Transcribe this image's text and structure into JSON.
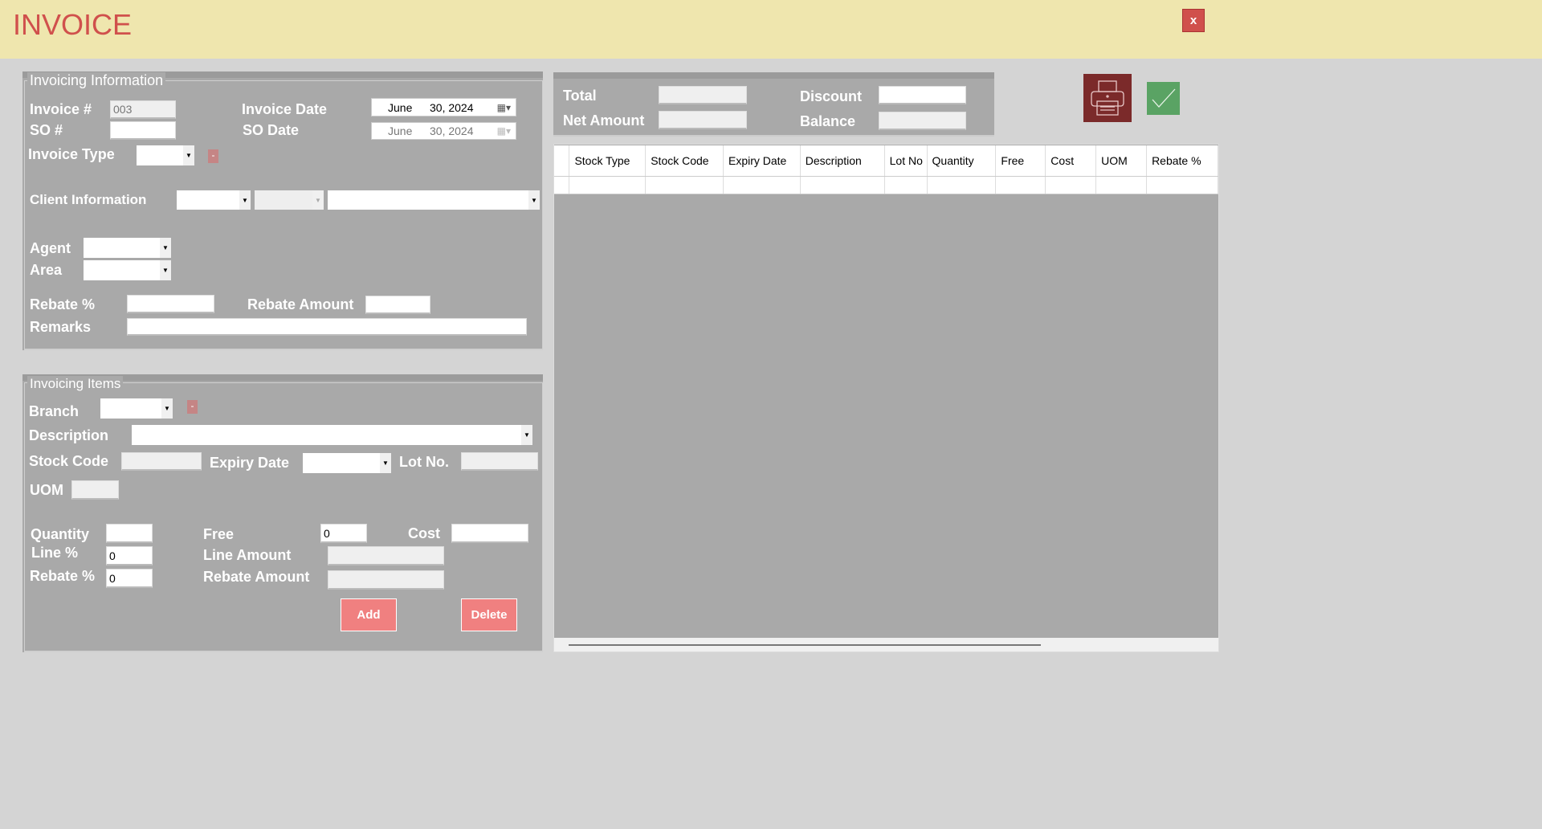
{
  "header": {
    "title": "INVOICE",
    "close_label": "x"
  },
  "info": {
    "legend": "Invoicing Information",
    "invoice_no_label": "Invoice #",
    "invoice_no": "003",
    "invoice_date_label": "Invoice Date",
    "invoice_date": {
      "month": "June",
      "day_year": "30, 2024"
    },
    "so_label": "SO #",
    "so_value": "",
    "so_date_label": "SO Date",
    "so_date": {
      "month": "June",
      "day_year": "30, 2024"
    },
    "invoice_type_label": "Invoice Type",
    "minus": "-",
    "client_label": "Client Information",
    "agent_label": "Agent",
    "area_label": "Area",
    "rebate_pct_label": "Rebate %",
    "rebate_amount_label": "Rebate Amount",
    "remarks_label": "Remarks"
  },
  "items": {
    "legend": "Invoicing Items",
    "branch_label": "Branch",
    "minus": "-",
    "description_label": "Description",
    "stock_code_label": "Stock Code",
    "expiry_label": "Expiry Date",
    "lot_label": "Lot No.",
    "uom_label": "UOM",
    "quantity_label": "Quantity",
    "free_label": "Free",
    "free_value": "0",
    "cost_label": "Cost",
    "line_pct_label": "Line %",
    "line_pct_value": "0",
    "line_amount_label": "Line Amount",
    "rebate_pct_label": "Rebate %",
    "rebate_pct_value": "0",
    "rebate_amount_label": "Rebate Amount",
    "add_label": "Add",
    "delete_label": "Delete"
  },
  "totals": {
    "total_label": "Total",
    "net_label": "Net Amount",
    "discount_label": "Discount",
    "balance_label": "Balance"
  },
  "grid": {
    "columns": [
      "Stock Type",
      "Stock Code",
      "Expiry Date",
      "Description",
      "Lot No",
      "Quantity",
      "Free",
      "Cost",
      "UOM",
      "Rebate %"
    ]
  },
  "colors": {
    "header_bg": "#efe6ae",
    "accent": "#d0504c",
    "panel": "#a9a9a9",
    "print": "#7b2a2a",
    "confirm": "#5aa364"
  }
}
